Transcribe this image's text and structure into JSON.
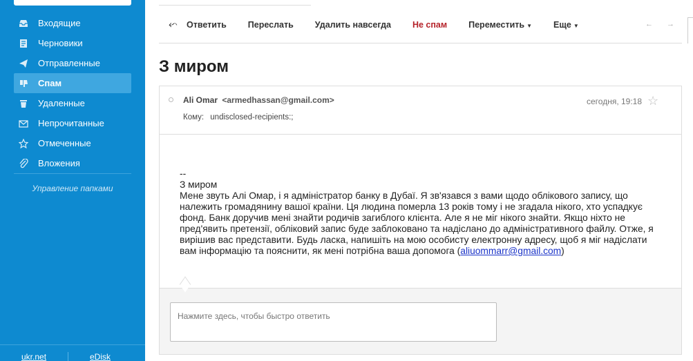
{
  "sidebar": {
    "items": [
      {
        "label": "Входящие",
        "icon": "inbox-icon"
      },
      {
        "label": "Черновики",
        "icon": "draft-icon"
      },
      {
        "label": "Отправленные",
        "icon": "sent-icon"
      },
      {
        "label": "Спам",
        "icon": "spam-icon",
        "active": true
      },
      {
        "label": "Удаленные",
        "icon": "trash-icon"
      },
      {
        "label": "Непрочитанные",
        "icon": "unread-icon"
      },
      {
        "label": "Отмеченные",
        "icon": "star-icon"
      },
      {
        "label": "Вложения",
        "icon": "attachment-icon"
      }
    ],
    "manage_label": "Управление папками",
    "footer": {
      "link1": "ukr.net",
      "link2": "eDisk"
    }
  },
  "toolbar": {
    "reply": "Ответить",
    "forward": "Переслать",
    "delete_forever": "Удалить навсегда",
    "not_spam": "Не спам",
    "move": "Переместить",
    "more": "Еще",
    "prev": "←",
    "next": "→"
  },
  "message": {
    "subject": "З миром",
    "from_name": "Ali Omar",
    "from_addr": "<armedhassan@gmail.com>",
    "date": "сегодня, 19:18",
    "to_label": "Кому:",
    "to_value": "undisclosed-recipients:;",
    "sig_sep": "--",
    "greeting": "З миром",
    "body_text": "Мене звуть Алі Омар, і я адміністратор банку в Дубаї. Я зв'язався з вами щодо облікового запису, що належить громадянину вашої країни. Ця людина померла 13 років тому і не згадала нікого, хто успадкує фонд. Банк доручив мені знайти родичів загиблого клієнта. Але я не міг нікого знайти. Якщо ніхто не пред'явить претензії, обліковий запис буде заблоковано та надіслано до адміністративного файлу. Отже, я вирішив вас представити. Будь ласка, напишіть на мою особисту електронну адресу, щоб я міг надіслати вам інформацію та пояснити, як мені потрібна ваша допомога (",
    "body_link": "aliuommarr@gmail.com",
    "body_end": ")"
  },
  "reply": {
    "placeholder": "Нажмите здесь, чтобы быстро ответить"
  },
  "colors": {
    "sidebar_bg": "#0e8ad0",
    "sidebar_active": "#3fa7e0",
    "not_spam": "#b5232a",
    "link": "#1a33c8"
  }
}
